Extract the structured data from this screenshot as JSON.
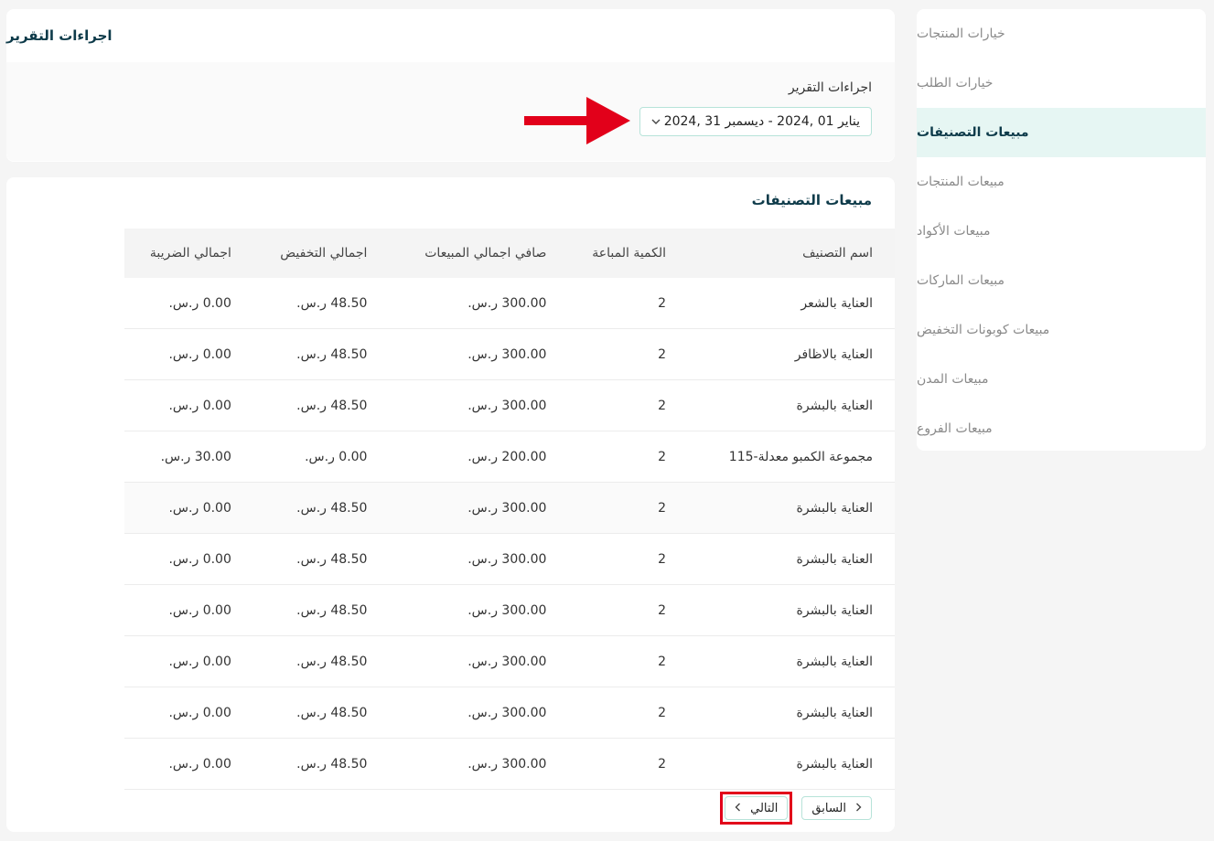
{
  "sidebar": {
    "items": [
      {
        "label": "خيارات المنتجات"
      },
      {
        "label": "خيارات الطلب"
      },
      {
        "label": "مبيعات التصنيفات"
      },
      {
        "label": "مبيعات المنتجات"
      },
      {
        "label": "مبيعات الأكواد"
      },
      {
        "label": "مبيعات الماركات"
      },
      {
        "label": "مبيعات كوبونات التخفيض"
      },
      {
        "label": "مبيعات المدن"
      },
      {
        "label": "مبيعات الفروع"
      }
    ],
    "active_index": 2
  },
  "report_actions": {
    "title": "اجراءات التقرير",
    "field_label": "اجراءات التقرير",
    "date_range": "يناير 01 ,2024 - ديسمبر 31 ,2024"
  },
  "table": {
    "title": "مبيعات التصنيفات",
    "headers": [
      "اسم التصنيف",
      "الكمية المباعة",
      "صافي اجمالي المبيعات",
      "اجمالي التخفيض",
      "اجمالي الضريبة"
    ],
    "rows": [
      [
        "العناية بالشعر",
        "2",
        "300.00 ر.س.",
        "48.50 ر.س.",
        "0.00 ر.س."
      ],
      [
        "العناية بالاظافر",
        "2",
        "300.00 ر.س.",
        "48.50 ر.س.",
        "0.00 ر.س."
      ],
      [
        "العناية بالبشرة",
        "2",
        "300.00 ر.س.",
        "48.50 ر.س.",
        "0.00 ر.س."
      ],
      [
        "مجموعة الكمبو معدلة-115",
        "2",
        "200.00 ر.س.",
        "0.00 ر.س.",
        "30.00 ر.س."
      ],
      [
        "العناية بالبشرة",
        "2",
        "300.00 ر.س.",
        "48.50 ر.س.",
        "0.00 ر.س."
      ],
      [
        "العناية بالبشرة",
        "2",
        "300.00 ر.س.",
        "48.50 ر.س.",
        "0.00 ر.س."
      ],
      [
        "العناية بالبشرة",
        "2",
        "300.00 ر.س.",
        "48.50 ر.س.",
        "0.00 ر.س."
      ],
      [
        "العناية بالبشرة",
        "2",
        "300.00 ر.س.",
        "48.50 ر.س.",
        "0.00 ر.س."
      ],
      [
        "العناية بالبشرة",
        "2",
        "300.00 ر.س.",
        "48.50 ر.س.",
        "0.00 ر.س."
      ],
      [
        "العناية بالبشرة",
        "2",
        "300.00 ر.س.",
        "48.50 ر.س.",
        "0.00 ر.س."
      ]
    ]
  },
  "pagination": {
    "prev_label": "السابق",
    "next_label": "التالي"
  },
  "colors": {
    "accent": "#b7e3d9",
    "active_bg": "#e6f6f3",
    "title": "#0e3b4a",
    "annotation_red": "#e2001a"
  },
  "icons": {
    "dropdown": "chevron-down-icon",
    "prev": "chevron-right-icon",
    "next": "chevron-left-icon",
    "annotation": "arrow-right-icon"
  }
}
